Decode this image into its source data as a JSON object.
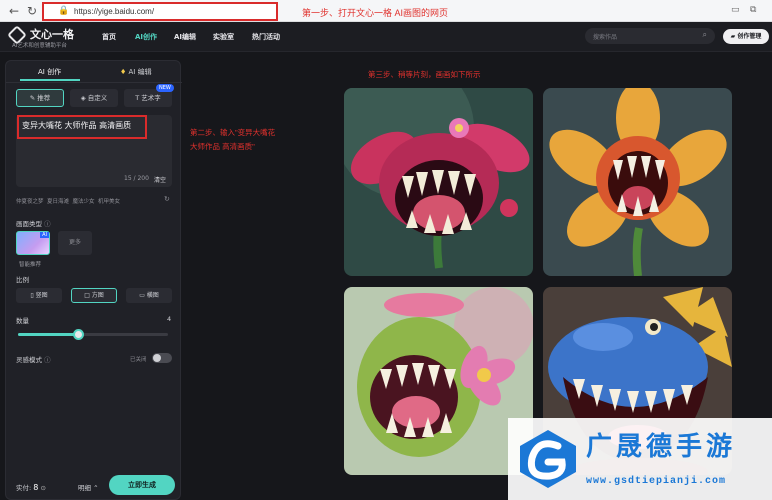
{
  "browser": {
    "back_icon": "back-arrow-icon",
    "reload_icon": "reload-icon",
    "url": "https://yige.baidu.com/",
    "annotation_step1": "第一步、打开文心一格 AI画图的网页"
  },
  "header": {
    "logo_name": "文心一格",
    "logo_sub": "AI艺术和创意辅助平台",
    "nav": [
      "首页",
      "AI创作",
      "AI编辑",
      "实验室",
      "热门活动"
    ],
    "active_nav": "AI创作",
    "search_placeholder": "搜索作品",
    "manage_label": "创作管理"
  },
  "panel": {
    "tabs": [
      "AI 创作",
      "AI 编辑"
    ],
    "modes": [
      "推荐",
      "自定义",
      "艺术字"
    ],
    "new_badge": "NEW",
    "prompt": "变异大嘴花 大师作品 高清画质",
    "char_count": "15 / 200",
    "clear_label": "清空",
    "suggestions": "featured: 仲夏夜之梦  夏日海滩  魔法少女  机甲美女",
    "style_label": "画面类型",
    "style_selected": "智能推荐",
    "style_more": "更多",
    "ai_tag": "AI",
    "ratio_label": "比例",
    "ratios": [
      "竖图",
      "方图",
      "横图"
    ],
    "selected_ratio": "方图",
    "quantity_label": "数量",
    "quantity_value": "4",
    "quantity_fraction": 0.4,
    "inspiration_label": "灵感模式",
    "inspiration_state": "已关闭",
    "credits_label": "实付: ",
    "credits_value": "8",
    "detail_label": "明细",
    "generate_label": "立即生成"
  },
  "annotations": {
    "step2_line1": "第二步、输入\"变异大嘴花",
    "step2_line2": "大师作品 高清画质\"",
    "step3": "第三步、稍等片刻，画画如下所示"
  },
  "watermark": {
    "title": "广晟德手游",
    "url": "www.gsdtiepianji.com"
  },
  "colors": {
    "accent": "#52d5c2",
    "annotation_red": "#e0312d",
    "watermark_blue": "#1b78d6"
  }
}
